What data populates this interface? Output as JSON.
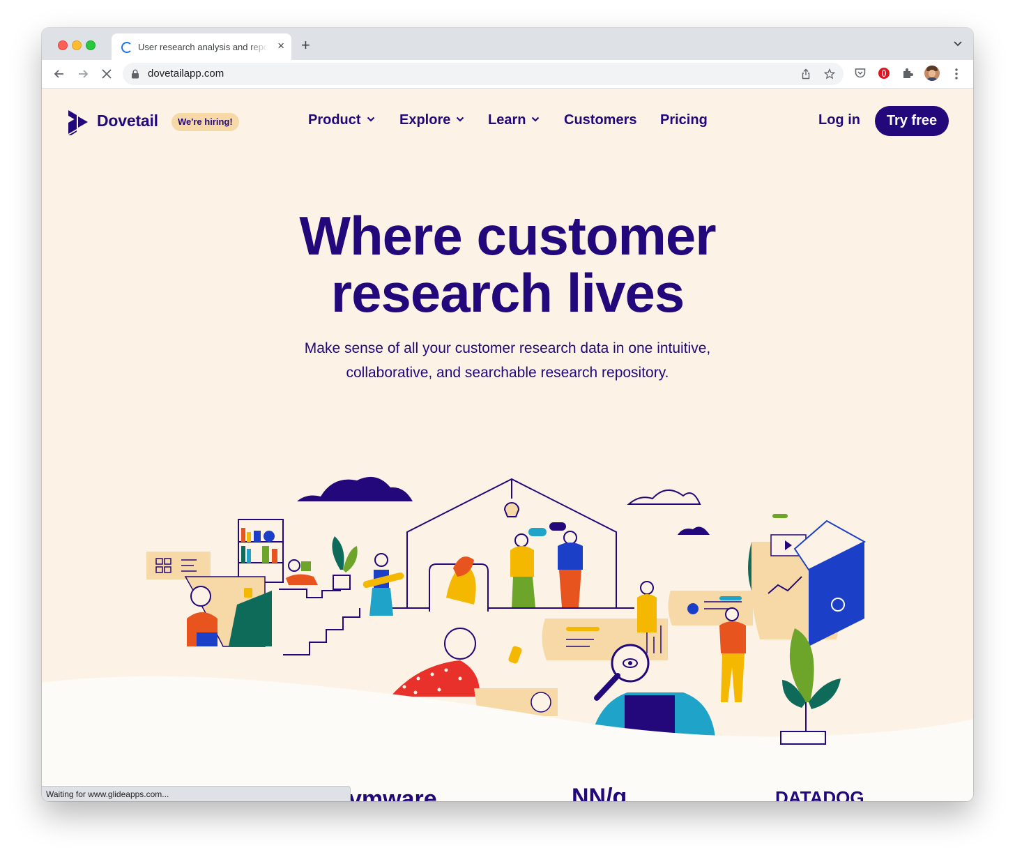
{
  "browser": {
    "tab_title": "User research analysis and repository",
    "url": "dovetailapp.com",
    "status_text": "Waiting for www.glideapps.com..."
  },
  "site": {
    "brand": "Dovetail",
    "badge": "We're hiring!",
    "nav": {
      "product": "Product",
      "explore": "Explore",
      "learn": "Learn",
      "customers": "Customers",
      "pricing": "Pricing"
    },
    "login": "Log in",
    "cta": "Try free"
  },
  "hero": {
    "title_line1": "Where customer",
    "title_line2": "research lives",
    "subtitle_line1": "Make sense of all your customer research data in one intuitive,",
    "subtitle_line2": "collaborative, and searchable research repository."
  },
  "customer_logos": {
    "vmware": "vmware",
    "nng": "NN/g",
    "datadog": "DATADOG"
  },
  "colors": {
    "brand_navy": "#22087a",
    "page_bg": "#fcf3e6",
    "badge_bg": "#f7d9a7",
    "wave_bg": "#fdfbf7"
  },
  "icons": [
    "back-arrow-icon",
    "forward-arrow-icon",
    "stop-loading-icon",
    "lock-icon",
    "share-icon",
    "star-icon",
    "pocket-icon",
    "opera-icon",
    "extensions-icon",
    "kebab-menu-icon",
    "tab-search-icon",
    "chevron-down-icon"
  ]
}
